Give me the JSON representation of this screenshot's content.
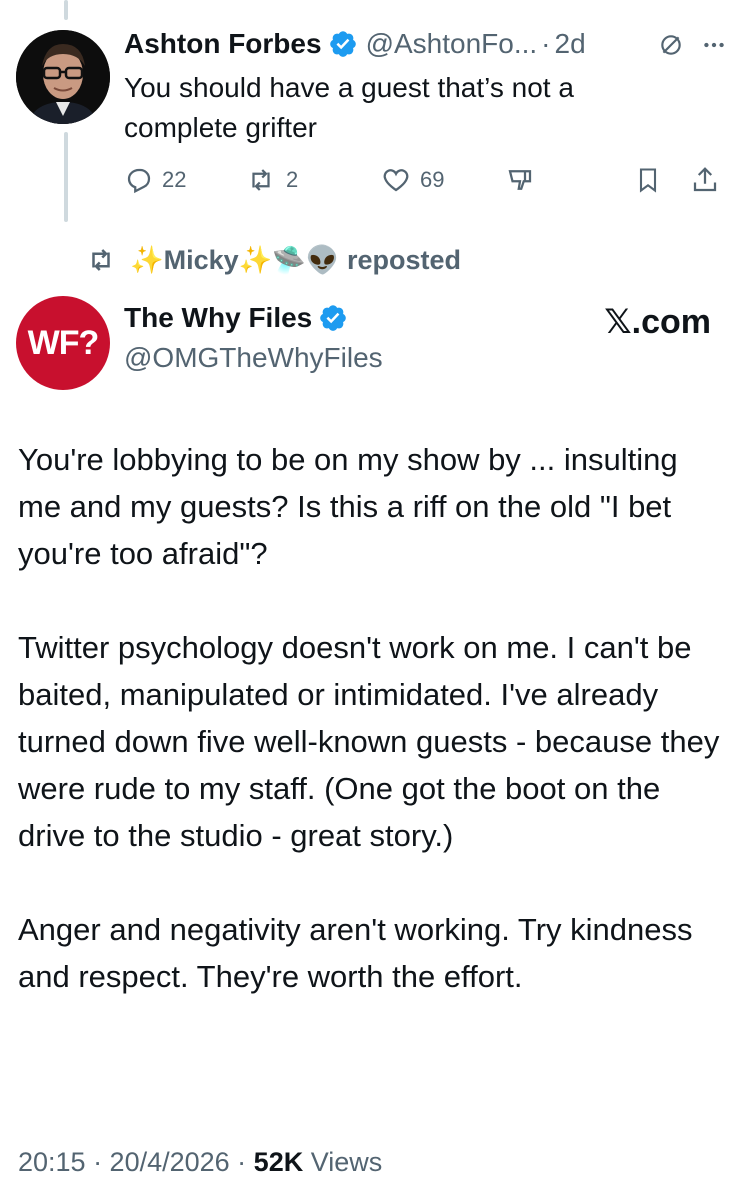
{
  "parent_tweet": {
    "author_name": "Ashton Forbes",
    "handle_time": "@AshtonFo...",
    "separator": "·",
    "time": "2d",
    "text": "You should have a guest that’s not a complete grifter",
    "replies": "22",
    "reposts": "2",
    "likes": "69"
  },
  "repost_bar": {
    "label": "✨Micky✨🛸👽 reposted"
  },
  "main_tweet": {
    "author_name": "The Why Files",
    "handle": "@OMGTheWhyFiles",
    "avatar_text": "WF?",
    "source_label": "𝕏.com",
    "paragraphs": [
      "You're lobbying to be on my show by ... insulting me and my guests? Is this a riff on the old \"I bet you're too afraid\"?",
      "Twitter psychology doesn't work on me. I can't be baited, manipulated or intimidated. I've already turned down five well-known guests - because they were rude to my staff. (One got the boot on the drive to the studio - great story.)",
      "Anger and negativity aren't working. Try kindness and respect. They're worth the effort."
    ],
    "timestamp": "20:15 · 20/4/2026 · ",
    "views_count": "52K",
    "views_label": " Views"
  },
  "colors": {
    "verified_blue": "#1d9bf0",
    "muted_text": "#536471",
    "brand_red": "#c8102e",
    "thread_line": "#cfd9de"
  }
}
